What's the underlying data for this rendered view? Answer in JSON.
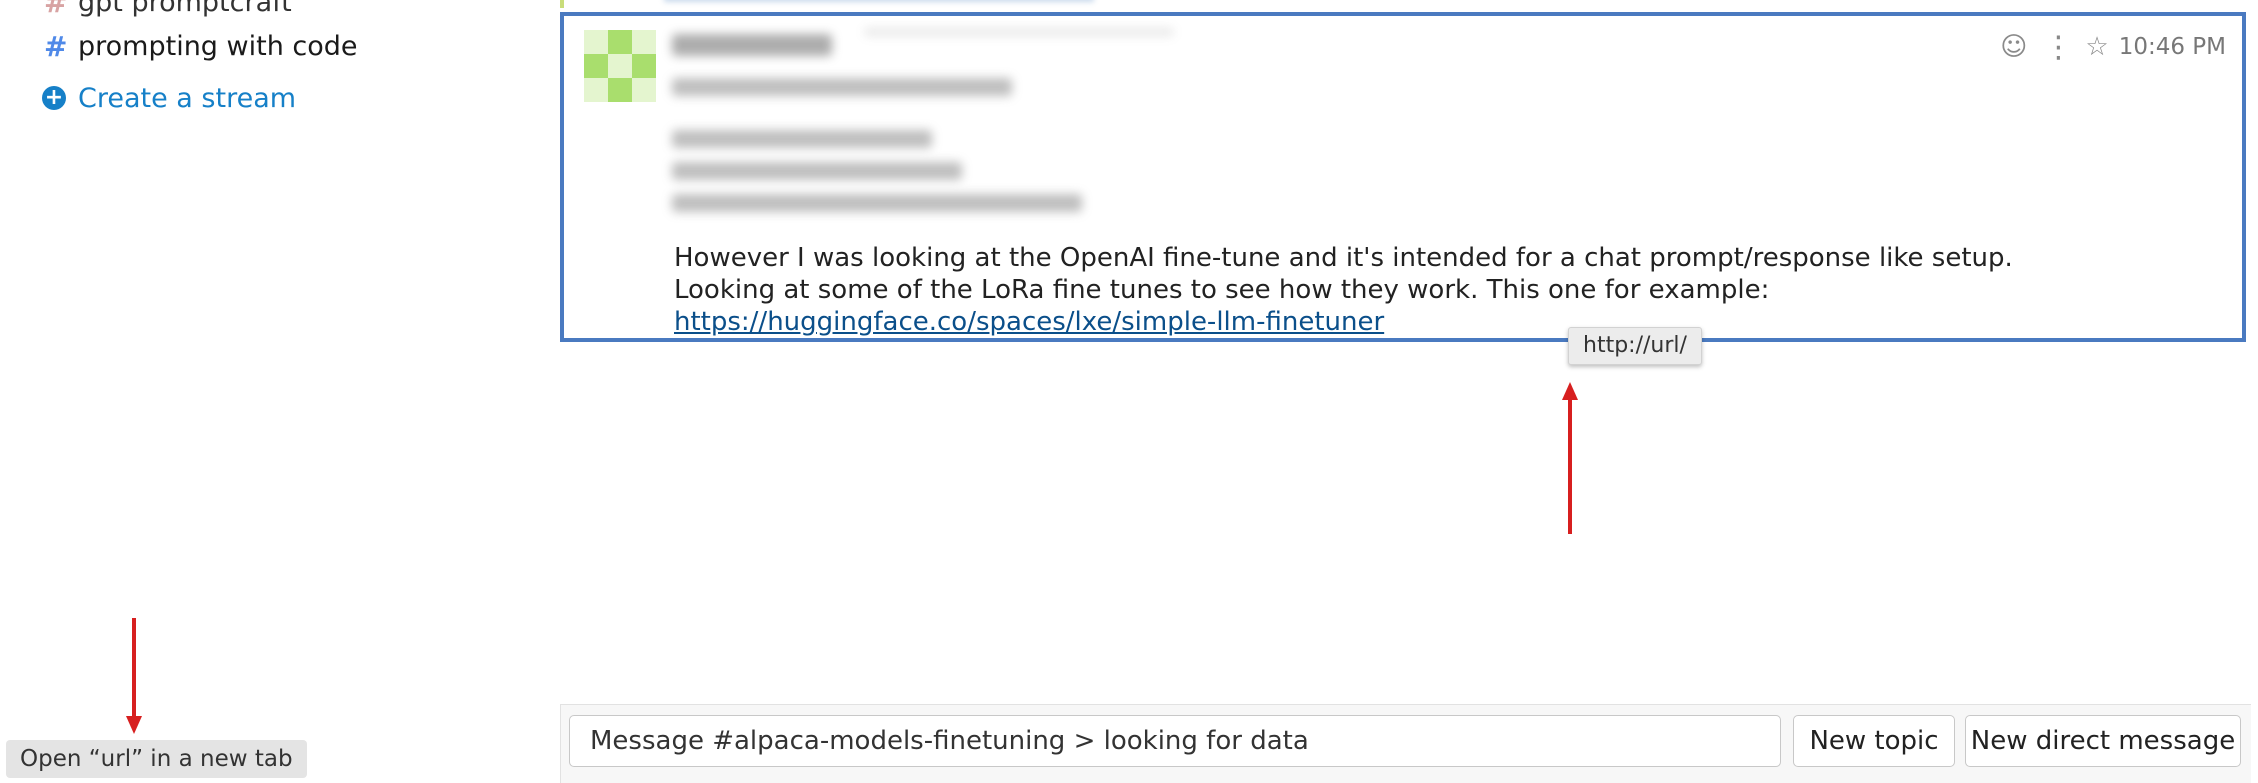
{
  "sidebar": {
    "streams": [
      {
        "name": "gpt promptcraft"
      },
      {
        "name": "prompting with code"
      }
    ],
    "create_stream_label": "Create a stream"
  },
  "message": {
    "time": "10:46 PM",
    "body_text": "However I was looking at the OpenAI fine-tune and it's intended for a chat prompt/response like setup. Looking at some of the LoRa fine tunes to see how they work. This one for example: ",
    "link_text": "https://huggingface.co/spaces/lxe/simple-llm-finetuner"
  },
  "link_tooltip": "http://url/",
  "compose": {
    "placeholder": "Message #alpaca-models-finetuning > looking for data",
    "new_topic_label": "New topic",
    "new_dm_label": "New direct message"
  },
  "status_tooltip": "Open “url” in a new tab",
  "colors": {
    "accent": "#1680c8",
    "highlight_border": "#4a7ac0",
    "annotation_arrow": "#d71f1f"
  }
}
